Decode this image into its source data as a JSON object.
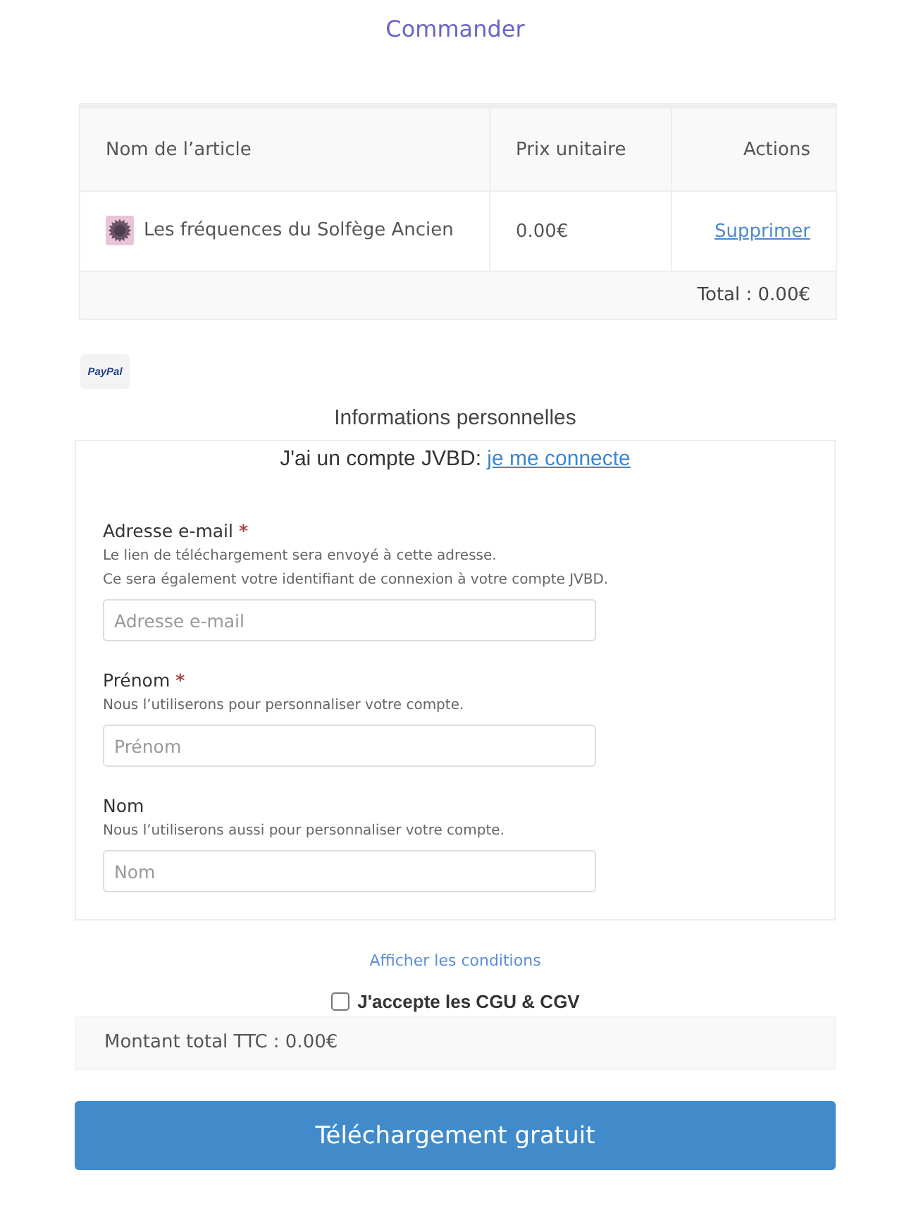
{
  "title": "Commander",
  "cart": {
    "columns": [
      "Nom de l’article",
      "Prix unitaire",
      "Actions"
    ],
    "rows": [
      {
        "item": "Les fréquences du Solfège Ancien",
        "price": "0.00€",
        "action": "Supprimer"
      }
    ],
    "total": "Total : 0.00€"
  },
  "payment_logo": "PayPal",
  "personal_info": {
    "title": "Informations personnelles",
    "account_prompt": "J'ai un compte JVBD:",
    "login_link": "je me connecte",
    "fields": [
      {
        "label": "Adresse e-mail",
        "required_mark": "*",
        "help": [
          "Le lien de téléchargement sera envoyé à cette adresse.",
          "Ce sera également votre identifiant de connexion à votre compte JVBD."
        ],
        "placeholder": "Adresse e-mail"
      },
      {
        "label": "Prénom",
        "required_mark": "*",
        "help": [
          "Nous l’utiliserons pour personnaliser votre compte."
        ],
        "placeholder": "Prénom"
      },
      {
        "label": "Nom",
        "help": [
          "Nous l’utiliserons aussi pour personnaliser votre compte."
        ],
        "placeholder": "Nom"
      }
    ]
  },
  "conditions_link": "Afficher les conditions",
  "terms": {
    "label": "J'accepte les CGU & CGV",
    "checked": false
  },
  "order_total": "Montant total TTC : 0.00€",
  "submit_button": "Téléchargement gratuit"
}
